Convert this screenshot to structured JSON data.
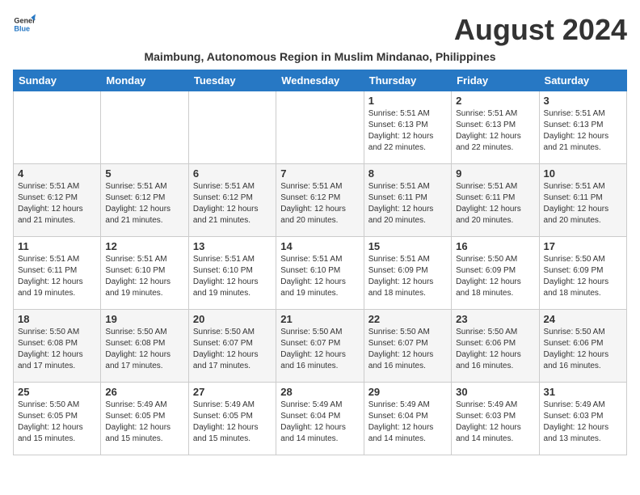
{
  "logo": {
    "line1": "General",
    "line2": "Blue"
  },
  "title": "August 2024",
  "subtitle": "Maimbung, Autonomous Region in Muslim Mindanao, Philippines",
  "days_of_week": [
    "Sunday",
    "Monday",
    "Tuesday",
    "Wednesday",
    "Thursday",
    "Friday",
    "Saturday"
  ],
  "weeks": [
    [
      {
        "day": "",
        "info": ""
      },
      {
        "day": "",
        "info": ""
      },
      {
        "day": "",
        "info": ""
      },
      {
        "day": "",
        "info": ""
      },
      {
        "day": "1",
        "info": "Sunrise: 5:51 AM\nSunset: 6:13 PM\nDaylight: 12 hours\nand 22 minutes."
      },
      {
        "day": "2",
        "info": "Sunrise: 5:51 AM\nSunset: 6:13 PM\nDaylight: 12 hours\nand 22 minutes."
      },
      {
        "day": "3",
        "info": "Sunrise: 5:51 AM\nSunset: 6:13 PM\nDaylight: 12 hours\nand 21 minutes."
      }
    ],
    [
      {
        "day": "4",
        "info": "Sunrise: 5:51 AM\nSunset: 6:12 PM\nDaylight: 12 hours\nand 21 minutes."
      },
      {
        "day": "5",
        "info": "Sunrise: 5:51 AM\nSunset: 6:12 PM\nDaylight: 12 hours\nand 21 minutes."
      },
      {
        "day": "6",
        "info": "Sunrise: 5:51 AM\nSunset: 6:12 PM\nDaylight: 12 hours\nand 21 minutes."
      },
      {
        "day": "7",
        "info": "Sunrise: 5:51 AM\nSunset: 6:12 PM\nDaylight: 12 hours\nand 20 minutes."
      },
      {
        "day": "8",
        "info": "Sunrise: 5:51 AM\nSunset: 6:11 PM\nDaylight: 12 hours\nand 20 minutes."
      },
      {
        "day": "9",
        "info": "Sunrise: 5:51 AM\nSunset: 6:11 PM\nDaylight: 12 hours\nand 20 minutes."
      },
      {
        "day": "10",
        "info": "Sunrise: 5:51 AM\nSunset: 6:11 PM\nDaylight: 12 hours\nand 20 minutes."
      }
    ],
    [
      {
        "day": "11",
        "info": "Sunrise: 5:51 AM\nSunset: 6:11 PM\nDaylight: 12 hours\nand 19 minutes."
      },
      {
        "day": "12",
        "info": "Sunrise: 5:51 AM\nSunset: 6:10 PM\nDaylight: 12 hours\nand 19 minutes."
      },
      {
        "day": "13",
        "info": "Sunrise: 5:51 AM\nSunset: 6:10 PM\nDaylight: 12 hours\nand 19 minutes."
      },
      {
        "day": "14",
        "info": "Sunrise: 5:51 AM\nSunset: 6:10 PM\nDaylight: 12 hours\nand 19 minutes."
      },
      {
        "day": "15",
        "info": "Sunrise: 5:51 AM\nSunset: 6:09 PM\nDaylight: 12 hours\nand 18 minutes."
      },
      {
        "day": "16",
        "info": "Sunrise: 5:50 AM\nSunset: 6:09 PM\nDaylight: 12 hours\nand 18 minutes."
      },
      {
        "day": "17",
        "info": "Sunrise: 5:50 AM\nSunset: 6:09 PM\nDaylight: 12 hours\nand 18 minutes."
      }
    ],
    [
      {
        "day": "18",
        "info": "Sunrise: 5:50 AM\nSunset: 6:08 PM\nDaylight: 12 hours\nand 17 minutes."
      },
      {
        "day": "19",
        "info": "Sunrise: 5:50 AM\nSunset: 6:08 PM\nDaylight: 12 hours\nand 17 minutes."
      },
      {
        "day": "20",
        "info": "Sunrise: 5:50 AM\nSunset: 6:07 PM\nDaylight: 12 hours\nand 17 minutes."
      },
      {
        "day": "21",
        "info": "Sunrise: 5:50 AM\nSunset: 6:07 PM\nDaylight: 12 hours\nand 16 minutes."
      },
      {
        "day": "22",
        "info": "Sunrise: 5:50 AM\nSunset: 6:07 PM\nDaylight: 12 hours\nand 16 minutes."
      },
      {
        "day": "23",
        "info": "Sunrise: 5:50 AM\nSunset: 6:06 PM\nDaylight: 12 hours\nand 16 minutes."
      },
      {
        "day": "24",
        "info": "Sunrise: 5:50 AM\nSunset: 6:06 PM\nDaylight: 12 hours\nand 16 minutes."
      }
    ],
    [
      {
        "day": "25",
        "info": "Sunrise: 5:50 AM\nSunset: 6:05 PM\nDaylight: 12 hours\nand 15 minutes."
      },
      {
        "day": "26",
        "info": "Sunrise: 5:49 AM\nSunset: 6:05 PM\nDaylight: 12 hours\nand 15 minutes."
      },
      {
        "day": "27",
        "info": "Sunrise: 5:49 AM\nSunset: 6:05 PM\nDaylight: 12 hours\nand 15 minutes."
      },
      {
        "day": "28",
        "info": "Sunrise: 5:49 AM\nSunset: 6:04 PM\nDaylight: 12 hours\nand 14 minutes."
      },
      {
        "day": "29",
        "info": "Sunrise: 5:49 AM\nSunset: 6:04 PM\nDaylight: 12 hours\nand 14 minutes."
      },
      {
        "day": "30",
        "info": "Sunrise: 5:49 AM\nSunset: 6:03 PM\nDaylight: 12 hours\nand 14 minutes."
      },
      {
        "day": "31",
        "info": "Sunrise: 5:49 AM\nSunset: 6:03 PM\nDaylight: 12 hours\nand 13 minutes."
      }
    ]
  ]
}
